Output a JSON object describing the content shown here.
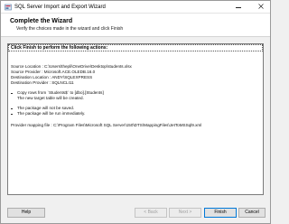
{
  "window": {
    "title": "SQL Server Import and Export Wizard"
  },
  "banner": {
    "title": "Complete the Wizard",
    "subtitle": "Verify the choices made in the wizard and click Finish"
  },
  "summary": {
    "header": "Click Finish to perform the following actions:",
    "lines": [
      "Source Location : C:\\Users\\thepli\\OneDrive\\Desktop\\students.xlsx",
      "Source Provider : Microsoft.ACE.OLEDB.16.0",
      "Destination Location : ANDY\\SQLEXPRESS",
      "Destination Provider : SQLNCLI11"
    ],
    "bullets": [
      {
        "text": "Copy rows from `Students$` to [dbo].[Students]",
        "sub": "The new target table will be created."
      },
      {
        "text": "The package will not be saved.",
        "sub": ""
      },
      {
        "text": "The package will be run immediately.",
        "sub": ""
      }
    ],
    "mapping": "Provider mapping file : C:\\Program Files\\Microsoft SQL Server\\150\\DTS\\MappingFiles\\JetToMSSql9.xml"
  },
  "buttons": {
    "help": "Help",
    "back": "< Back",
    "next": "Next >",
    "finish": "Finish",
    "cancel": "Cancel"
  },
  "colors": {
    "accent": "#0078d7",
    "window_bg": "#f0f0f0"
  }
}
